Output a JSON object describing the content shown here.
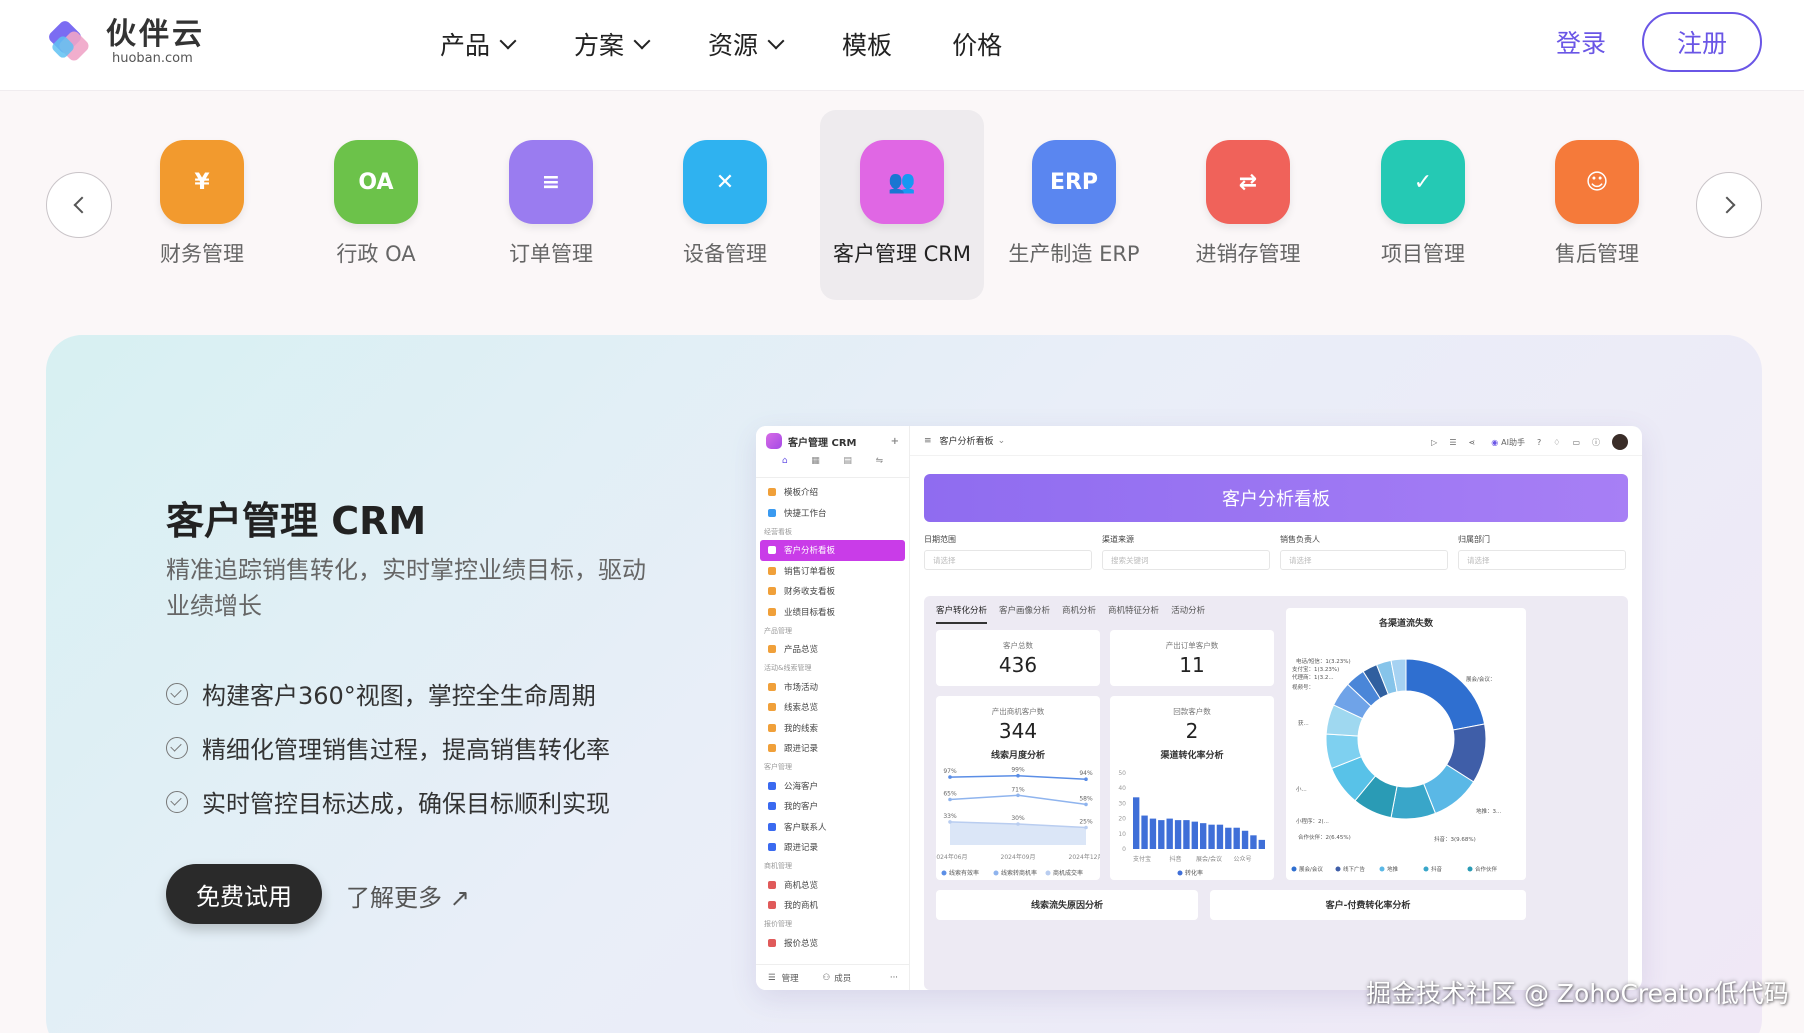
{
  "header": {
    "logo_cn": "伙伴云",
    "logo_en": "huoban.com",
    "nav": [
      {
        "label": "产品",
        "dropdown": true
      },
      {
        "label": "方案",
        "dropdown": true
      },
      {
        "label": "资源",
        "dropdown": true
      },
      {
        "label": "模板",
        "dropdown": false
      },
      {
        "label": "价格",
        "dropdown": false
      }
    ],
    "login": "登录",
    "register": "注册"
  },
  "apps": [
    {
      "label": "财务管理",
      "icon": "money-bag-icon",
      "glyph": "¥",
      "color": "#f29a2e",
      "active": false
    },
    {
      "label": "行政 OA",
      "icon": "oa-icon",
      "glyph": "OA",
      "color": "#6cc24a",
      "active": false
    },
    {
      "label": "订单管理",
      "icon": "document-icon",
      "glyph": "≡",
      "color": "#9a7cf0",
      "active": false
    },
    {
      "label": "设备管理",
      "icon": "tools-icon",
      "glyph": "✕",
      "color": "#2fb2f0",
      "active": false
    },
    {
      "label": "客户管理 CRM",
      "icon": "users-icon",
      "glyph": "👥",
      "color": "#e067e4",
      "active": true
    },
    {
      "label": "生产制造 ERP",
      "icon": "erp-icon",
      "glyph": "ERP",
      "color": "#5a86f0",
      "active": false
    },
    {
      "label": "进销存管理",
      "icon": "warehouse-icon",
      "glyph": "⇄",
      "color": "#f0625a",
      "active": false
    },
    {
      "label": "项目管理",
      "icon": "clipboard-icon",
      "glyph": "✓",
      "color": "#25c9b4",
      "active": false
    },
    {
      "label": "售后管理",
      "icon": "headset-icon",
      "glyph": "☺",
      "color": "#f57a3a",
      "active": false
    }
  ],
  "hero": {
    "title": "客户管理 CRM",
    "subtitle": "精准追踪销售转化，实时掌控业绩目标，驱动业绩增长",
    "features": [
      "构建客户360°视图，掌控全生命周期",
      "精细化管理销售过程，提高销售转化率",
      "实时管控目标达成，确保目标顺利实现"
    ],
    "trial": "免费试用",
    "learn_more": "了解更多 ↗"
  },
  "dashboard": {
    "app_name": "客户管理 CRM",
    "page": "客户分析看板",
    "ai": "AI助手",
    "banner": "客户分析看板",
    "sidebar": [
      {
        "type": "item",
        "label": "模板介绍",
        "color": "#f0a03a"
      },
      {
        "type": "item",
        "label": "快捷工作台",
        "color": "#3a9af0"
      },
      {
        "type": "group",
        "label": "经营看板"
      },
      {
        "type": "item",
        "label": "客户分析看板",
        "color": "#ffffff",
        "selected": true
      },
      {
        "type": "item",
        "label": "销售订单看板",
        "color": "#f0a03a"
      },
      {
        "type": "item",
        "label": "财务收支看板",
        "color": "#f0a03a"
      },
      {
        "type": "item",
        "label": "业绩目标看板",
        "color": "#f0a03a"
      },
      {
        "type": "group",
        "label": "产品管理"
      },
      {
        "type": "item",
        "label": "产品总览",
        "color": "#f0a03a"
      },
      {
        "type": "group",
        "label": "活动&线索管理"
      },
      {
        "type": "item",
        "label": "市场活动",
        "color": "#f0a03a"
      },
      {
        "type": "item",
        "label": "线索总览",
        "color": "#f0a03a"
      },
      {
        "type": "item",
        "label": "我的线索",
        "color": "#f0a03a"
      },
      {
        "type": "item",
        "label": "跟进记录",
        "color": "#f0a03a"
      },
      {
        "type": "group",
        "label": "客户管理"
      },
      {
        "type": "item",
        "label": "公海客户",
        "color": "#3a6af0"
      },
      {
        "type": "item",
        "label": "我的客户",
        "color": "#3a6af0"
      },
      {
        "type": "item",
        "label": "客户联系人",
        "color": "#3a6af0"
      },
      {
        "type": "item",
        "label": "跟进记录",
        "color": "#3a6af0"
      },
      {
        "type": "group",
        "label": "商机管理"
      },
      {
        "type": "item",
        "label": "商机总览",
        "color": "#e05a5a"
      },
      {
        "type": "item",
        "label": "我的商机",
        "color": "#e05a5a"
      },
      {
        "type": "group",
        "label": "报价管理"
      },
      {
        "type": "item",
        "label": "报价总览",
        "color": "#e05a5a"
      }
    ],
    "sidebar_footer": [
      "管理",
      "成员"
    ],
    "filters": [
      {
        "label": "日期范围",
        "placeholder": "请选择"
      },
      {
        "label": "渠道来源",
        "placeholder": "搜索关键词"
      },
      {
        "label": "销售负责人",
        "placeholder": "请选择"
      },
      {
        "label": "归属部门",
        "placeholder": "请选择"
      }
    ],
    "tabs": [
      "客户转化分析",
      "客户画像分析",
      "商机分析",
      "商机特征分析",
      "活动分析"
    ],
    "kpis": [
      {
        "label": "客户总数",
        "value": "436"
      },
      {
        "label": "产出订单客户数",
        "value": "11"
      },
      {
        "label": "产出商机客户数",
        "value": "344"
      },
      {
        "label": "回款客户数",
        "value": "2"
      }
    ],
    "chart_titles": {
      "line": "线索月度分析",
      "bar": "渠道转化率分析",
      "donut": "各渠道流失数",
      "bottom_left": "线索流失原因分析",
      "bottom_right": "客户-付费转化率分析"
    }
  },
  "chart_data": [
    {
      "type": "line",
      "title": "线索月度分析",
      "x": [
        "2024年06月",
        "2024年09月",
        "2024年12月"
      ],
      "series": [
        {
          "name": "线索有效率",
          "values": [
            97,
            99,
            94
          ]
        },
        {
          "name": "线索转商机率",
          "values": [
            65,
            71,
            58
          ]
        },
        {
          "name": "商机成交率",
          "values": [
            33,
            30,
            25
          ]
        }
      ]
    },
    {
      "type": "bar",
      "title": "渠道转化率分析",
      "categories": [
        "支付宝",
        "抖音",
        "展会/会议",
        "公众号"
      ],
      "ylim": [
        0,
        50
      ],
      "series": [
        {
          "name": "转化率",
          "values": [
            34,
            22,
            20,
            19,
            20,
            19,
            19,
            18,
            17,
            16,
            16,
            14,
            14,
            12,
            9,
            6
          ]
        }
      ]
    },
    {
      "type": "pie",
      "title": "各渠道流失数",
      "legend": [
        "展会/会议",
        "线下广告",
        "地推",
        "抖音",
        "合作伙伴"
      ],
      "annotations": [
        "电话/短信：1(3.23%)",
        "支付宝：1(3.23%)",
        "代理商：1(3.2...",
        "视频号：",
        "展会/会议：",
        "地推：3...",
        "抖音：3(9.68%)",
        "合作伙伴：2(6.45%)",
        "小程序：2(...",
        "获...",
        "小..."
      ],
      "values": [
        22,
        12,
        10,
        9,
        8,
        8,
        7,
        6,
        5,
        4,
        3,
        3,
        3
      ]
    }
  ],
  "watermark": "掘金技术社区 @ ZohoCreator低代码"
}
